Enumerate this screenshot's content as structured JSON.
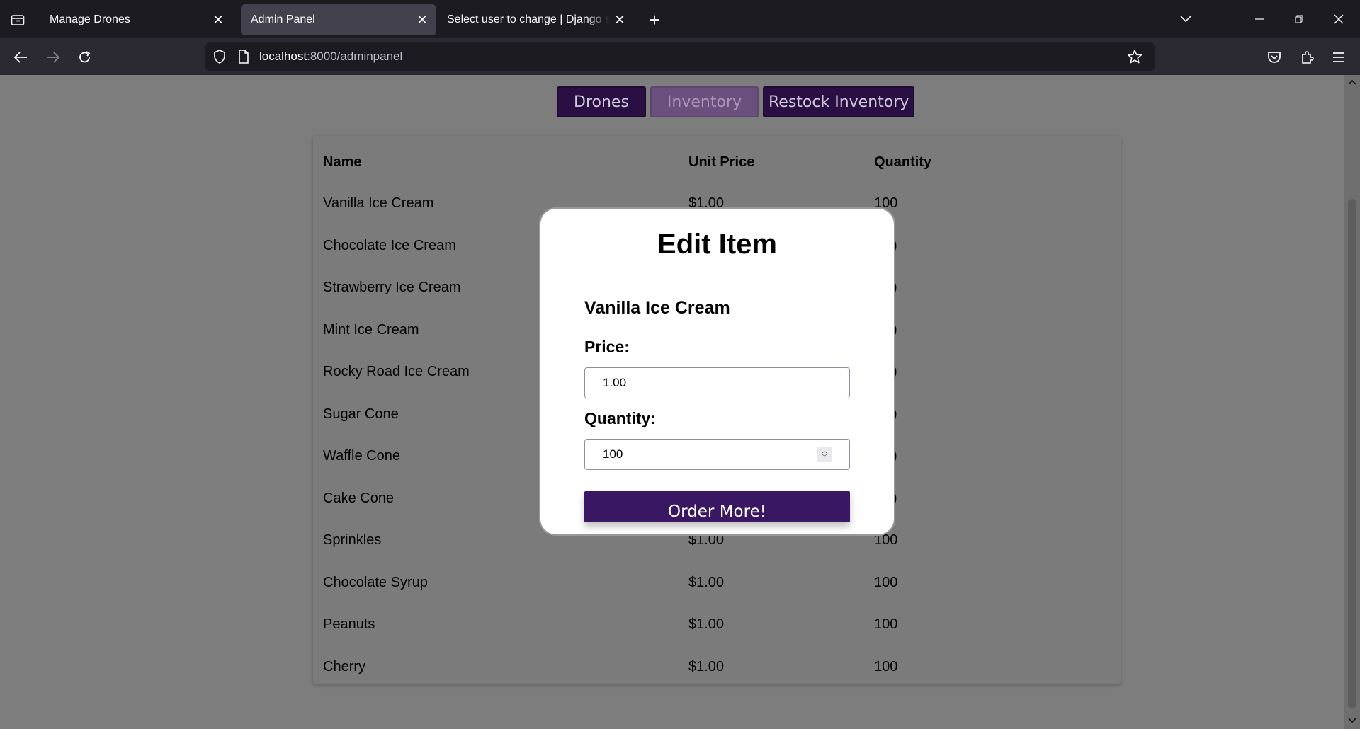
{
  "browser": {
    "tabs": [
      {
        "label": "Manage Drones",
        "active": false
      },
      {
        "label": "Admin Panel",
        "active": true
      },
      {
        "label": "Select user to change | Django site admin",
        "active": false
      }
    ],
    "url_host": "localhost",
    "url_path": ":8000/adminpanel"
  },
  "nav": {
    "drones": "Drones",
    "inventory": "Inventory",
    "restock": "Restock Inventory"
  },
  "table": {
    "headers": [
      "Name",
      "Unit Price",
      "Quantity"
    ],
    "rows": [
      {
        "name": "Vanilla Ice Cream",
        "price": "$1.00",
        "qty": "100"
      },
      {
        "name": "Chocolate Ice Cream",
        "price": "",
        "qty": ")"
      },
      {
        "name": "Strawberry Ice Cream",
        "price": "",
        "qty": ")"
      },
      {
        "name": "Mint Ice Cream",
        "price": "",
        "qty": ")"
      },
      {
        "name": "Rocky Road Ice Cream",
        "price": "",
        "qty": ")"
      },
      {
        "name": "Sugar Cone",
        "price": "",
        "qty": ")"
      },
      {
        "name": "Waffle Cone",
        "price": "",
        "qty": ")"
      },
      {
        "name": "Cake Cone",
        "price": "",
        "qty": ")"
      },
      {
        "name": "Sprinkles",
        "price": "$1.00",
        "qty": "100"
      },
      {
        "name": "Chocolate Syrup",
        "price": "$1.00",
        "qty": "100"
      },
      {
        "name": "Peanuts",
        "price": "$1.00",
        "qty": "100"
      },
      {
        "name": "Cherry",
        "price": "$1.00",
        "qty": "100"
      }
    ]
  },
  "modal": {
    "title": "Edit Item",
    "item_name": "Vanilla Ice Cream",
    "price_label": "Price:",
    "price_value": "1.00",
    "quantity_label": "Quantity:",
    "quantity_value": "100",
    "order_button": "Order More!"
  },
  "colors": {
    "accent": "#3a1763",
    "nav_button": "#2a0f45",
    "nav_active": "#6b507e"
  }
}
